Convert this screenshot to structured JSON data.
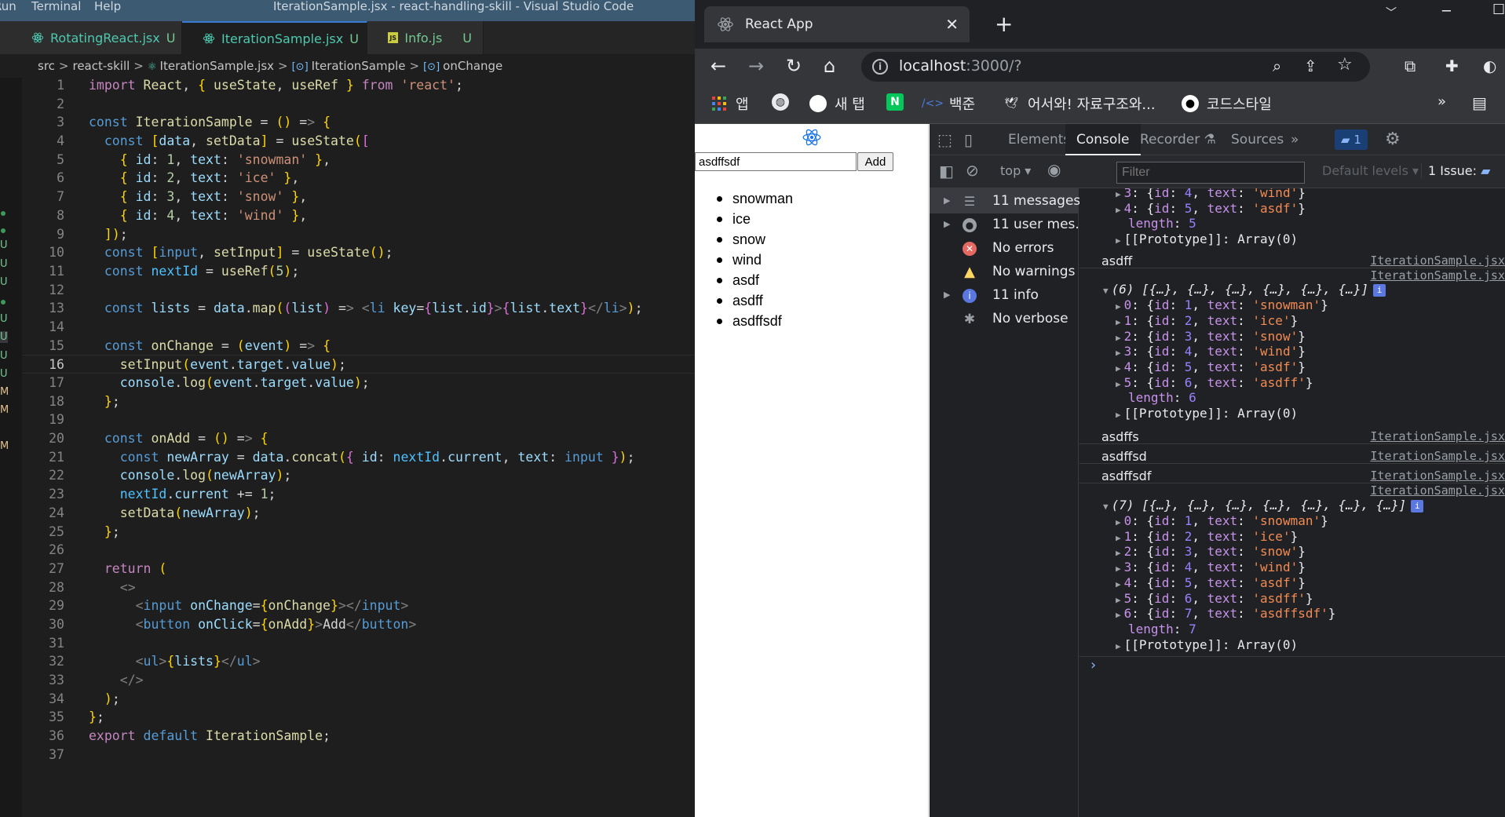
{
  "vscode": {
    "menu": [
      "Run",
      "Terminal",
      "Help"
    ],
    "window_title": "IterationSample.jsx - react-handling-skill - Visual Studio Code",
    "tabs": [
      {
        "label": "RotatingReact.jsx",
        "badge": "U",
        "icon": "react-icon"
      },
      {
        "label": "IterationSample.jsx",
        "badge": "U",
        "icon": "react-icon",
        "close": "✕"
      },
      {
        "label": "Info.js",
        "badge": "U",
        "icon": "js-icon"
      }
    ],
    "breadcrumb": [
      "src",
      "react-skill",
      "IterationSample.jsx",
      "IterationSample",
      "onChange"
    ],
    "gutter_badges": [
      "U",
      "U",
      "U",
      "U",
      "U",
      "U",
      "U",
      "M",
      "M",
      "M"
    ],
    "current_line": 16,
    "lines": [
      "import React, { useState, useRef } from 'react';",
      "",
      "const IterationSample = () => {",
      "  const [data, setData] = useState([",
      "    { id: 1, text: 'snowman' },",
      "    { id: 2, text: 'ice' },",
      "    { id: 3, text: 'snow' },",
      "    { id: 4, text: 'wind' },",
      "  ]);",
      "  const [input, setInput] = useState();",
      "  const nextId = useRef(5);",
      "",
      "  const lists = data.map((list) => <li key={list.id}>{list.text}</li>);",
      "",
      "  const onChange = (event) => {",
      "    setInput(event.target.value);",
      "    console.log(event.target.value);",
      "  };",
      "",
      "  const onAdd = () => {",
      "    const newArray = data.concat({ id: nextId.current, text: input });",
      "    console.log(newArray);",
      "    nextId.current += 1;",
      "    setData(newArray);",
      "  };",
      "",
      "  return (",
      "    <>",
      "      <input onChange={onChange}></input>",
      "      <button onClick={onAdd}>Add</button>",
      "",
      "      <ul>{lists}</ul>",
      "    </>",
      "  );",
      "};",
      "export default IterationSample;",
      ""
    ]
  },
  "chrome": {
    "tab_title": "React App",
    "tab_close": "✕",
    "new_tab": "+",
    "url_host": "localhost",
    "url_rest": ":3000/?",
    "bookmarks": [
      {
        "label": "앱",
        "icon": "apps-grid-icon"
      },
      {
        "label": "",
        "icon": "globe-icon"
      },
      {
        "label": "새 탭",
        "icon": "new-tab-icon"
      },
      {
        "label": "",
        "icon": "naver-icon"
      },
      {
        "label": "백준",
        "icon": "baekjoon-icon"
      },
      {
        "label": "어서와! 자료구조와...",
        "icon": "bird-icon"
      },
      {
        "label": "코드스타일",
        "icon": "github-icon"
      }
    ],
    "more": "»"
  },
  "page": {
    "input_value": "asdffsdf",
    "add_label": "Add",
    "items": [
      "snowman",
      "ice",
      "snow",
      "wind",
      "asdf",
      "asdff",
      "asdffsdf"
    ]
  },
  "devtools": {
    "tabs": [
      "Elements",
      "Console",
      "Recorder",
      "Sources",
      "»"
    ],
    "active_tab": "Console",
    "issues_count": "1",
    "context": "top",
    "filter_placeholder": "Filter",
    "levels": "Default levels",
    "issue_badge": "1 Issue:",
    "sidebar": [
      {
        "label": "11 messages",
        "icon": "list-icon"
      },
      {
        "label": "11 user mes...",
        "icon": "user-icon"
      },
      {
        "label": "No errors",
        "icon": "error-icon"
      },
      {
        "label": "No warnings",
        "icon": "warning-icon"
      },
      {
        "label": "11 info",
        "icon": "info-icon"
      },
      {
        "label": "No verbose",
        "icon": "bug-icon"
      }
    ],
    "source_file": "IterationSample.jsx",
    "logs": {
      "top_items": [
        {
          "idx": "3",
          "id": "4",
          "text": "'wind'"
        },
        {
          "idx": "4",
          "id": "5",
          "text": "'asdf'"
        }
      ],
      "top_length": "5",
      "prototype": "[[Prototype]]: Array(0)",
      "msg1": "asdff",
      "arr6_header": "(6) [{…}, {…}, {…}, {…}, {…}, {…}]",
      "arr6": [
        {
          "idx": "0",
          "id": "1",
          "text": "'snowman'"
        },
        {
          "idx": "1",
          "id": "2",
          "text": "'ice'"
        },
        {
          "idx": "2",
          "id": "3",
          "text": "'snow'"
        },
        {
          "idx": "3",
          "id": "4",
          "text": "'wind'"
        },
        {
          "idx": "4",
          "id": "5",
          "text": "'asdf'"
        },
        {
          "idx": "5",
          "id": "6",
          "text": "'asdff'"
        }
      ],
      "arr6_length": "6",
      "msg2": "asdffs",
      "msg3": "asdffsd",
      "msg4": "asdffsdf",
      "arr7_header": "(7) [{…}, {…}, {…}, {…}, {…}, {…}, {…}]",
      "arr7": [
        {
          "idx": "0",
          "id": "1",
          "text": "'snowman'"
        },
        {
          "idx": "1",
          "id": "2",
          "text": "'ice'"
        },
        {
          "idx": "2",
          "id": "3",
          "text": "'snow'"
        },
        {
          "idx": "3",
          "id": "4",
          "text": "'wind'"
        },
        {
          "idx": "4",
          "id": "5",
          "text": "'asdf'"
        },
        {
          "idx": "5",
          "id": "6",
          "text": "'asdff'"
        },
        {
          "idx": "6",
          "id": "7",
          "text": "'asdffsdf'"
        }
      ],
      "arr7_length": "7",
      "prompt": "›"
    }
  },
  "colors": {
    "vscode_title_bar": "#3c5a72",
    "editor_bg": "#1e1e1e",
    "devtools_bg": "#202124",
    "console_key": "#c792ea",
    "console_string": "#f28b54",
    "console_number": "#9980ff"
  }
}
